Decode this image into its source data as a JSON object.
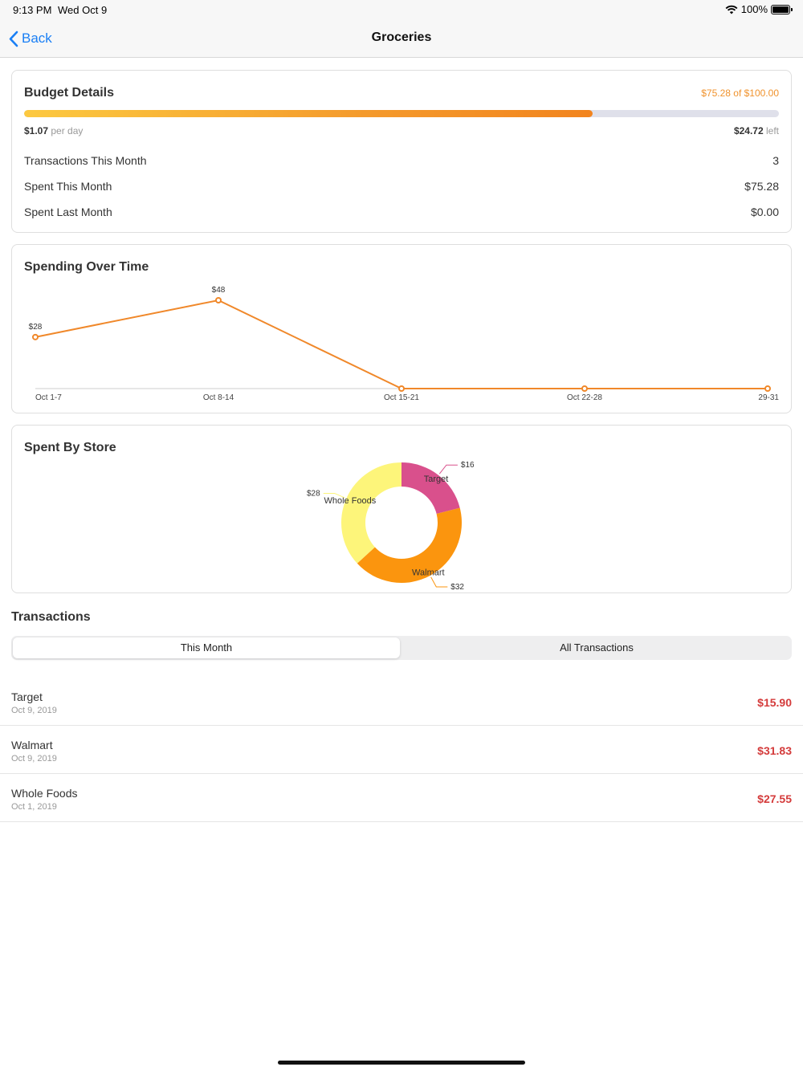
{
  "status": {
    "time": "9:13 PM",
    "date": "Wed Oct 9",
    "battery": "100%"
  },
  "nav": {
    "back_label": "Back",
    "title": "Groceries"
  },
  "budget": {
    "title": "Budget Details",
    "amount_text": "$75.28 of $100.00",
    "progress_fraction": 0.7528,
    "per_day_value": "$1.07",
    "per_day_label": "per day",
    "left_value": "$24.72",
    "left_label": "left",
    "rows": [
      {
        "label": "Transactions This Month",
        "value": "3"
      },
      {
        "label": "Spent This Month",
        "value": "$75.28"
      },
      {
        "label": "Spent Last Month",
        "value": "$0.00"
      }
    ]
  },
  "spending": {
    "title": "Spending Over Time"
  },
  "store": {
    "title": "Spent By Store"
  },
  "chart_data": [
    {
      "type": "line",
      "title": "Spending Over Time",
      "categories": [
        "Oct 1-7",
        "Oct 8-14",
        "Oct 15-21",
        "Oct 22-28",
        "29-31"
      ],
      "series": [
        {
          "values": [
            28,
            48,
            0,
            0,
            0
          ],
          "labels": [
            "$28",
            "$48",
            "",
            "",
            ""
          ],
          "color": "#f0882a"
        }
      ],
      "ylim": [
        0,
        48
      ],
      "grid": false
    },
    {
      "type": "pie",
      "title": "Spent By Store",
      "donut": true,
      "slices": [
        {
          "name": "Target",
          "value": 16,
          "label": "$16",
          "color": "#d9508c"
        },
        {
          "name": "Walmart",
          "value": 32,
          "label": "$32",
          "color": "#fb950e"
        },
        {
          "name": "Whole Foods",
          "value": 28,
          "label": "$28",
          "color": "#fdf57a"
        }
      ]
    }
  ],
  "transactions": {
    "title": "Transactions",
    "tabs": [
      {
        "label": "This Month",
        "active": true
      },
      {
        "label": "All Transactions",
        "active": false
      }
    ],
    "items": [
      {
        "name": "Target",
        "date": "Oct 9, 2019",
        "amount": "$15.90"
      },
      {
        "name": "Walmart",
        "date": "Oct 9, 2019",
        "amount": "$31.83"
      },
      {
        "name": "Whole Foods",
        "date": "Oct 1, 2019",
        "amount": "$27.55"
      }
    ]
  },
  "colors": {
    "accent": "#1a7ff5",
    "budget_orange": "#f0922c",
    "expense_red": "#d43b3b"
  }
}
